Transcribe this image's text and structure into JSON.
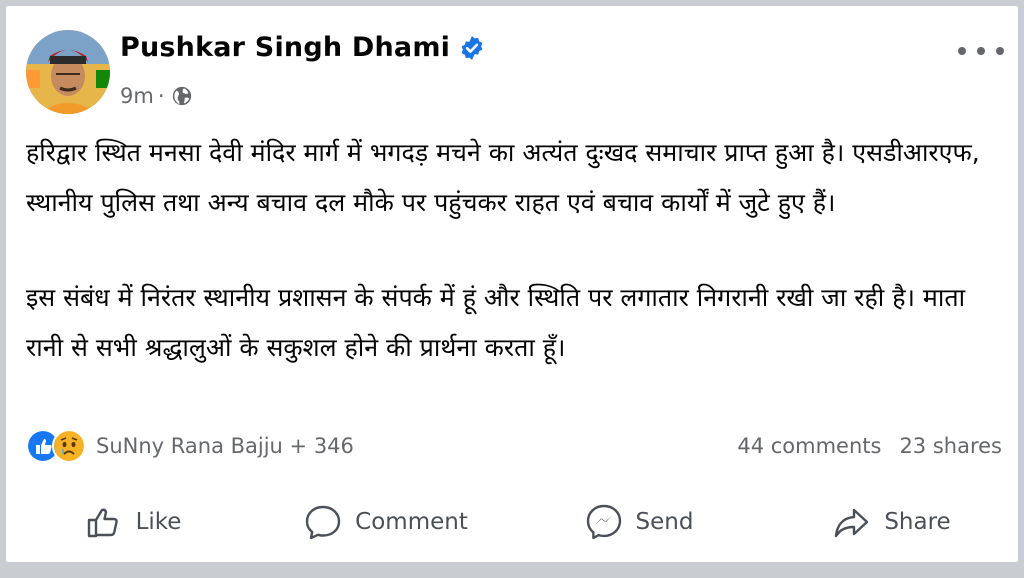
{
  "post": {
    "author": "Pushkar Singh Dhami",
    "time": "9m",
    "separator": "·",
    "paragraphs": [
      "हरिद्वार स्थित मनसा देवी मंदिर मार्ग में भगदड़ मचने का अत्यंत दुःखद समाचार प्राप्त हुआ है। एसडीआरएफ, स्थानीय पुलिस तथा अन्य बचाव दल मौके पर पहुंचकर राहत एवं बचाव कार्यों में जुटे हुए हैं।",
      "इस संबंध में निरंतर स्थानीय प्रशासन के संपर्क में हूं और स्थिति पर लगातार निगरानी रखी जा रही है। माता रानी से सभी श्रद्धालुओं के सकुशल होने की प्रार्थना करता हूँ।"
    ]
  },
  "reactions": {
    "names": "SuNny Rana Bajju + 346",
    "comments": "44 comments",
    "shares": "23 shares"
  },
  "actions": {
    "like": "Like",
    "comment": "Comment",
    "send": "Send",
    "share": "Share"
  },
  "colors": {
    "verified_blue": "#1b74e4",
    "like_blue": "#1877f2",
    "sad_yellow": "#f7b125",
    "secondary_text": "#65676b"
  },
  "icons": [
    "verified-badge-icon",
    "globe-icon",
    "more-options-icon",
    "like-reaction-icon",
    "sad-reaction-icon",
    "thumbs-up-icon",
    "comment-bubble-icon",
    "messenger-icon",
    "share-arrow-icon"
  ]
}
